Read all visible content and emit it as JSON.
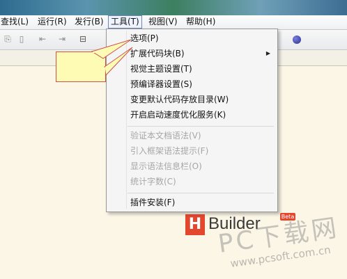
{
  "menubar": {
    "items": [
      {
        "label": "查找(L)"
      },
      {
        "label": "运行(R)"
      },
      {
        "label": "发行(B)"
      },
      {
        "label": "工具(T)"
      },
      {
        "label": "视图(V)"
      },
      {
        "label": "帮助(H)"
      }
    ],
    "active_index": 3
  },
  "toolbar": {
    "icons": [
      "clipboard-icon",
      "page-icon",
      "step-back-icon",
      "step-forward-icon",
      "note-icon",
      "globe-icon"
    ]
  },
  "tools_menu": {
    "items": [
      {
        "label": "选项(P)",
        "enabled": true
      },
      {
        "label": "扩展代码块(B)",
        "enabled": true,
        "submenu": true
      },
      {
        "label": "视觉主题设置(T)",
        "enabled": true
      },
      {
        "label": "预编译器设置(S)",
        "enabled": true
      },
      {
        "label": "变更默认代码存放目录(W)",
        "enabled": true
      },
      {
        "label": "开启启动速度优化服务(K)",
        "enabled": true
      },
      {
        "label": "验证本文档语法(V)",
        "enabled": false
      },
      {
        "label": "引入框架语法提示(F)",
        "enabled": false
      },
      {
        "label": "显示语法信息栏(O)",
        "enabled": false
      },
      {
        "label": "统计字数(C)",
        "enabled": false
      },
      {
        "label": "插件安装(F)",
        "enabled": true
      }
    ],
    "submenu_arrow": "▶"
  },
  "logo": {
    "letter": "H",
    "name": "Builder",
    "badge": "Beta"
  },
  "watermark": {
    "text": "PC下载网",
    "url": "www.pcsoft.com.cn"
  },
  "colors": {
    "editor_bg": "#fbf6e6",
    "accent": "#e3482f",
    "callout_fill": "#fdfbb4",
    "callout_border": "#d05050"
  }
}
